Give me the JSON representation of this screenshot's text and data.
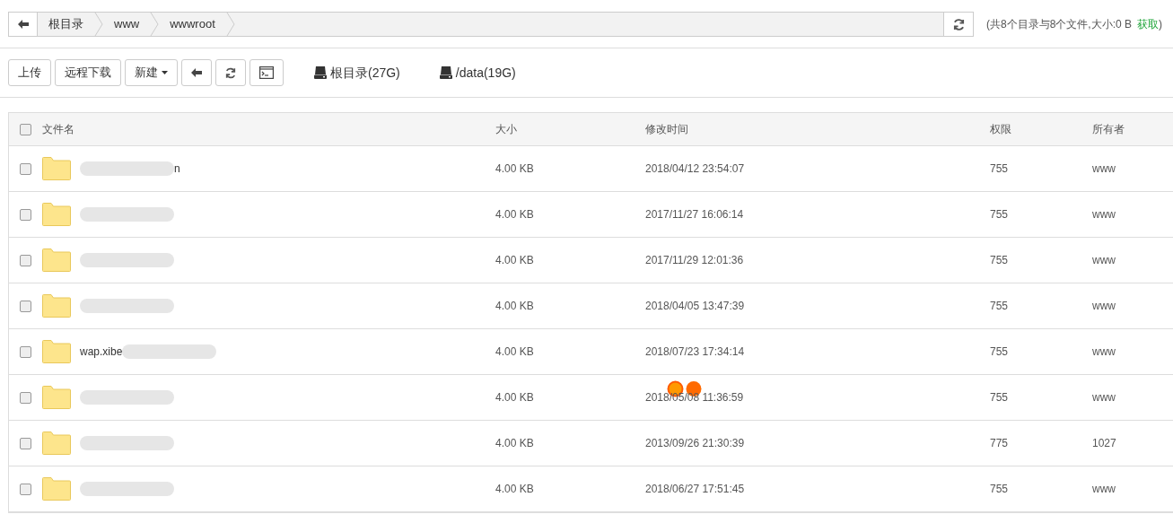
{
  "breadcrumb": {
    "items": [
      "根目录",
      "www",
      "wwwroot"
    ]
  },
  "summary": {
    "text": "(共8个目录与8个文件,大小:0 B",
    "link": "获取",
    "close": ")"
  },
  "toolbar": {
    "buttons": [
      {
        "kind": "text",
        "label": "上传"
      },
      {
        "kind": "text",
        "label": "远程下载"
      },
      {
        "kind": "dropdown",
        "label": "新建"
      },
      {
        "kind": "back"
      },
      {
        "kind": "refresh"
      },
      {
        "kind": "terminal"
      }
    ],
    "disks": [
      "根目录(27G)",
      "/data(19G)"
    ]
  },
  "table": {
    "columns": [
      "文件名",
      "大小",
      "修改时间",
      "权限",
      "所有者"
    ],
    "select_all": {
      "checked": false
    },
    "rows": [
      {
        "checked": false,
        "redacted": true,
        "name_suffix": "n",
        "size": "4.00 KB",
        "modified": "2018/04/12 23:54:07",
        "permission": "755",
        "owner": "www"
      },
      {
        "checked": false,
        "redacted": true,
        "size": "4.00 KB",
        "modified": "2017/11/27 16:06:14",
        "permission": "755",
        "owner": "www"
      },
      {
        "checked": false,
        "redacted": true,
        "size": "4.00 KB",
        "modified": "2017/11/29 12:01:36",
        "permission": "755",
        "owner": "www"
      },
      {
        "checked": false,
        "redacted": true,
        "size": "4.00 KB",
        "modified": "2018/04/05 13:47:39",
        "permission": "755",
        "owner": "www"
      },
      {
        "checked": false,
        "redacted": true,
        "name_prefix": "wap.xibe",
        "size": "4.00 KB",
        "modified": "2018/07/23 17:34:14",
        "permission": "755",
        "owner": "www"
      },
      {
        "checked": false,
        "redacted": true,
        "size": "4.00 KB",
        "modified": "2018/05/08 11:36:59",
        "permission": "755",
        "owner": "www"
      },
      {
        "checked": false,
        "redacted": true,
        "size": "4.00 KB",
        "modified": "2013/09/26 21:30:39",
        "permission": "775",
        "owner": "1027"
      },
      {
        "checked": false,
        "redacted": true,
        "size": "4.00 KB",
        "modified": "2018/06/27 17:51:45",
        "permission": "755",
        "owner": "www"
      }
    ]
  }
}
